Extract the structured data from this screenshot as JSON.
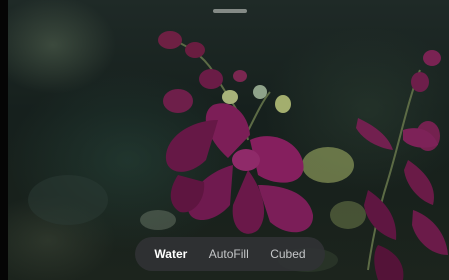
{
  "wallpaper_picker": {
    "preview_description_icon": "photo-wallpaper",
    "style_options": [
      {
        "label": "Water",
        "selected": true
      },
      {
        "label": "AutoFill",
        "selected": false
      },
      {
        "label": "Cubed",
        "selected": false
      }
    ]
  },
  "colors": {
    "bar_background": "#303234",
    "selected_text": "#ffffff",
    "unselected_text": "#c4c6c8",
    "orchid": "#7a1f5a"
  }
}
